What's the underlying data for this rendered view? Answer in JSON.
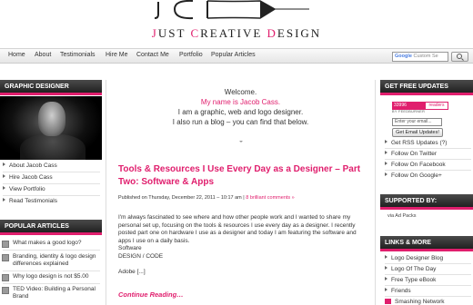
{
  "brand": {
    "title_parts": [
      "J",
      "UST ",
      "C",
      "REATIVE ",
      "D",
      "ESIGN"
    ],
    "accent": "#e01e6d"
  },
  "nav": {
    "items": [
      "Home",
      "About",
      "Testimonials",
      "Hire Me",
      "Contact Me",
      "Portfolio",
      "Popular Articles"
    ],
    "search_placeholder": "Custom Se"
  },
  "left_sidebar": {
    "graphic_designer": {
      "heading": "GRAPHIC DESIGNER",
      "links": [
        "About Jacob Cass",
        "Hire Jacob Cass",
        "View Portfolio",
        "Read Testimonials"
      ]
    },
    "popular": {
      "heading": "POPULAR ARTICLES",
      "items": [
        "What makes a good logo?",
        "Branding, identity & logo design differences explained",
        "Why logo design is not $5.00",
        "TED Video: Building a Personal Brand"
      ]
    }
  },
  "main": {
    "welcome": [
      "Welcome.",
      "My name is Jacob Cass.",
      "I am a graphic, web and logo designer.",
      "I also run a blog – you can find that below."
    ],
    "post": {
      "title": "Tools & Resources I Use Every Day as a Designer – Part Two: Software & Apps",
      "meta_prefix": "Published on Thursday, December 22, 2011 – 10:17 am |",
      "meta_comments": "8 brilliant comments »",
      "body": "I'm always fascinated to see where and how other people work and  I wanted to share my personal set up, focusing on the tools & resources I use every day as a designer. I recently posted part one on hardware I use as a designer and today I am featuring the software and apps I use on a daily basis.",
      "section_label": "Software",
      "sub_label": "DESIGN / CODE",
      "excerpt_end": "Adobe [...]",
      "continue": "Continue Reading…"
    }
  },
  "right_sidebar": {
    "updates": {
      "heading": "GET FREE UPDATES",
      "badge_left": "33996",
      "badge_right": "readers",
      "feedburner": "BY FEEDBURNER",
      "email_placeholder": "Enter your email...",
      "email_button": "Get Email Updates!",
      "links": [
        "Get RSS Updates (?)",
        "Follow On Twitter",
        "Follow On Facebook",
        "Follow On Google+"
      ]
    },
    "supported": {
      "heading": "SUPPORTED BY:",
      "via": "via Ad Packs"
    },
    "links_more": {
      "heading": "LINKS & MORE",
      "items": [
        "Logo Designer Blog",
        "Logo Of The Day",
        "Free Type eBook",
        "Friends",
        "Smashing Network"
      ]
    }
  }
}
